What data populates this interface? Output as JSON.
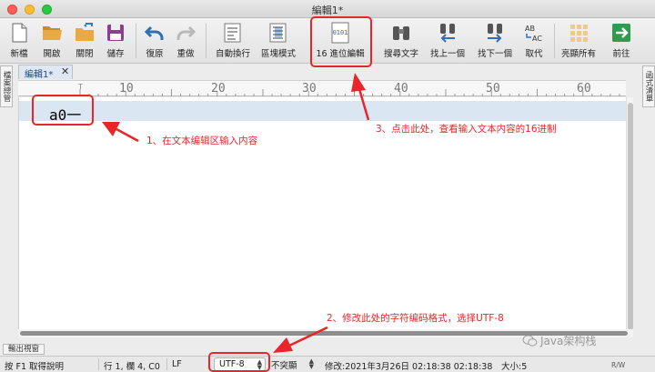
{
  "window": {
    "title": "編輯1*"
  },
  "toolbar": {
    "items": [
      {
        "id": "new",
        "label": "新檔",
        "icon": "new-file-icon"
      },
      {
        "id": "open",
        "label": "開啟",
        "icon": "open-folder-icon"
      },
      {
        "id": "close",
        "label": "關閉",
        "icon": "close-folder-icon"
      },
      {
        "id": "save",
        "label": "儲存",
        "icon": "save-disk-icon"
      },
      {
        "id": "undo",
        "label": "復原",
        "icon": "undo-arrow-icon"
      },
      {
        "id": "redo",
        "label": "重做",
        "icon": "redo-arrow-icon"
      },
      {
        "id": "wrap",
        "label": "自動換行",
        "icon": "word-wrap-icon"
      },
      {
        "id": "block",
        "label": "區塊模式",
        "icon": "block-mode-icon"
      },
      {
        "id": "hex",
        "label": "16 進位編輯",
        "icon": "hex-edit-icon",
        "icon_text": "0101"
      },
      {
        "id": "find",
        "label": "搜尋文字",
        "icon": "binoculars-icon"
      },
      {
        "id": "findprev",
        "label": "找上一個",
        "icon": "find-previous-icon"
      },
      {
        "id": "findnext",
        "label": "找下一個",
        "icon": "find-next-icon"
      },
      {
        "id": "replace",
        "label": "取代",
        "icon": "replace-icon",
        "icon_text_top": "AB",
        "icon_text_bottom": "AC"
      },
      {
        "id": "highlight",
        "label": "亮顯所有",
        "icon": "highlight-all-icon"
      },
      {
        "id": "goto",
        "label": "前往",
        "icon": "goto-arrow-icon"
      }
    ]
  },
  "side_panels": {
    "left": "檔案總管",
    "right": "函式清單"
  },
  "editor": {
    "tab_label": "編輯1*",
    "tab_close": "✕",
    "ruler_numbers": [
      "10",
      "20",
      "30",
      "40",
      "50",
      "60"
    ],
    "content": "a0一"
  },
  "bottom_panel": {
    "tab_label": "輸出視窗"
  },
  "statusbar": {
    "help": "按 F1 取得說明",
    "position": "行 1, 欄 4, C0",
    "line_ending": "LF",
    "encoding": "UTF-8",
    "highlight": "不突顯",
    "modified": "修改:2021年3月26日 02:18:38 02:18:38",
    "size": "大小:5",
    "mode": "R/W"
  },
  "annotations": [
    {
      "text": "1、在文本编辑区输入内容"
    },
    {
      "text": "2、修改此处的字符编码格式，选择UTF-8"
    },
    {
      "text": "3、点击此处，查看输入文本内容的16进制"
    }
  ],
  "watermark": {
    "text": "Java架构栈",
    "icon": "wechat-icon"
  },
  "colors": {
    "annotation": "#e8262a",
    "current_line": "#dbe6f3",
    "accent": "#1c4d88"
  }
}
